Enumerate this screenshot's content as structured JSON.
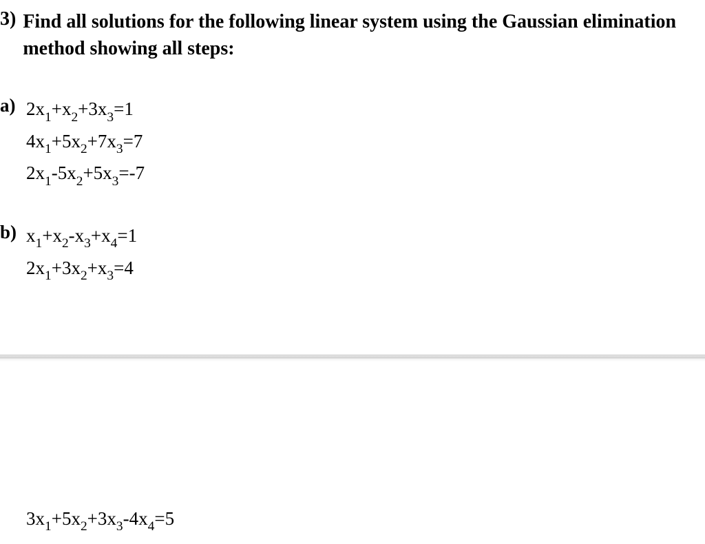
{
  "question": {
    "number": "3)",
    "text": "Find all solutions for the following linear system using the Gaussian elimination method showing all steps:"
  },
  "parts": {
    "a": {
      "label": "a)",
      "equations": [
        {
          "coef1": "2",
          "var1": "x",
          "sub1": "1",
          "op1": "+",
          "coef2": "",
          "var2": "x",
          "sub2": "2",
          "op2": "+",
          "coef3": "3",
          "var3": "x",
          "sub3": "3",
          "rhs": "=1"
        },
        {
          "coef1": "4",
          "var1": "x",
          "sub1": "1",
          "op1": "+",
          "coef2": "5",
          "var2": "x",
          "sub2": "2",
          "op2": "+",
          "coef3": "7",
          "var3": "x",
          "sub3": "3",
          "rhs": "=7"
        },
        {
          "coef1": "2",
          "var1": "x",
          "sub1": "1",
          "op1": "-",
          "coef2": "5",
          "var2": "x",
          "sub2": "2",
          "op2": "+",
          "coef3": "5",
          "var3": "x",
          "sub3": "3",
          "rhs": "=-7"
        }
      ]
    },
    "b": {
      "label": "b)",
      "equations": [
        {
          "terms": "x1+x2-x3+x4",
          "rhs": "=1"
        },
        {
          "terms": "2x1+3x2+x3",
          "rhs": "=4"
        }
      ]
    }
  },
  "bottom_equation": {
    "terms": "3x1+5x2+3x3-4x4",
    "rhs": "=5"
  },
  "b_eq1": {
    "c1": "",
    "s1": "1",
    "o1": "+",
    "c2": "",
    "s2": "2",
    "o2": "-",
    "c3": "",
    "s3": "3",
    "o3": "+",
    "c4": "",
    "s4": "4",
    "rhs": "=1"
  },
  "b_eq2": {
    "c1": "2",
    "s1": "1",
    "o1": "+",
    "c2": "3",
    "s2": "2",
    "o2": "+",
    "c3": "",
    "s3": "3",
    "rhs": "=4"
  },
  "bot": {
    "c1": "3",
    "s1": "1",
    "o1": "+",
    "c2": "5",
    "s2": "2",
    "o2": "+",
    "c3": "3",
    "s3": "3",
    "o3": "-",
    "c4": "4",
    "s4": "4",
    "rhs": "=5"
  }
}
